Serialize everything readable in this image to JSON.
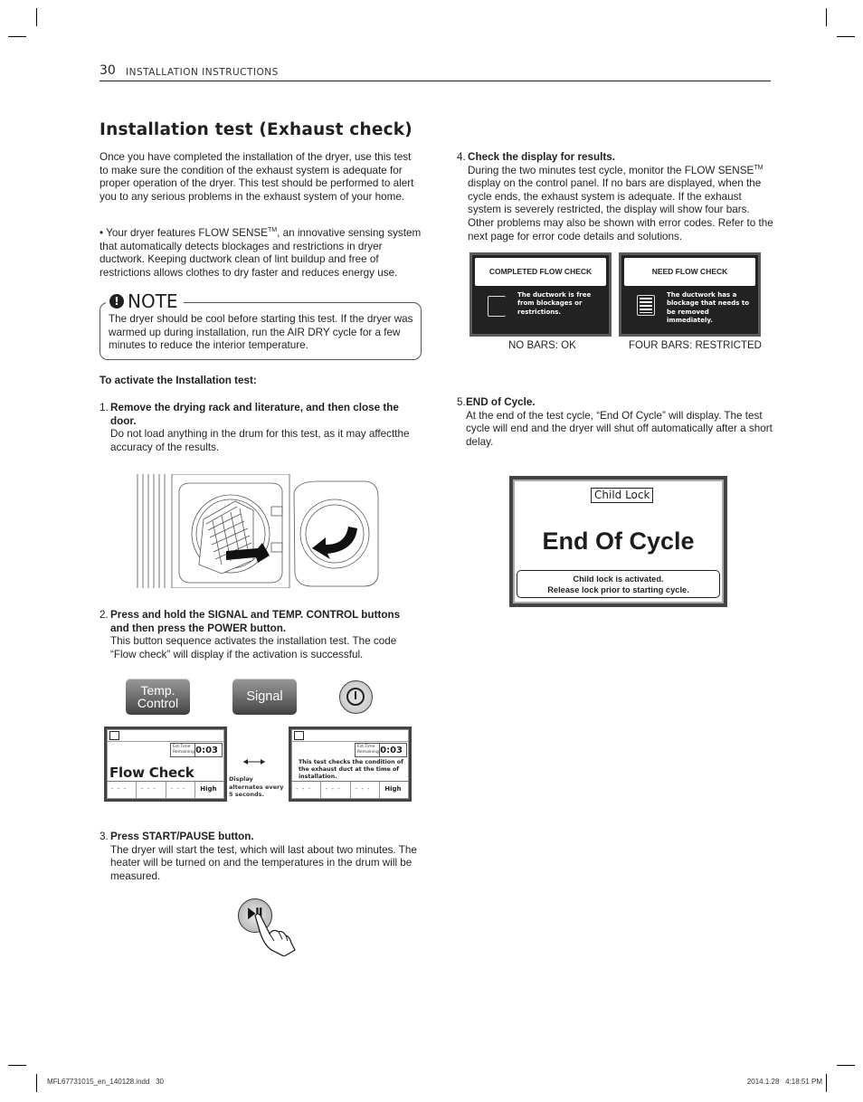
{
  "header": {
    "page_number": "30",
    "section": "INSTALLATION INSTRUCTIONS"
  },
  "title": "Installation test (Exhaust check)",
  "intro": {
    "paragraph": "Once you have completed the installation of the dryer, use this test to make sure the condition of the exhaust system is adequate for proper operation of the dryer. This test should be performed to alert you to any serious problems in the exhaust system of your home.",
    "bullet_pre": "• Your dryer features FLOW SENSE",
    "bullet_tm": "TM",
    "bullet_post": ", an innovative sensing system that automatically detects blockages and restrictions in dryer ductwork. Keeping ductwork clean of lint buildup and free of restrictions allows clothes to dry faster and reduces energy use."
  },
  "note": {
    "title": "NOTE",
    "icon": "exclamation-circle-icon",
    "text": "The dryer should be cool before starting this test. If the dryer was warmed up during installation, run the AIR DRY cycle for a few minutes to reduce the interior temperature."
  },
  "activate_heading": "To activate the Installation test:",
  "steps": [
    {
      "num": "1.",
      "heading": "Remove the drying rack and literature, and then close the door.",
      "text": "Do not load anything in the drum for this test, as it may affectthe accuracy of the results."
    },
    {
      "num": "2.",
      "heading": "Press and hold the SIGNAL and TEMP. CONTROL buttons and then press the POWER button.",
      "text": "This button sequence activates the installation test. The code “Flow check” will display if the activation is successful."
    },
    {
      "num": "3.",
      "heading": "Press START/PAUSE button.",
      "text": "The dryer will start the test, which will last about two minutes. The heater  will be turned on and the temperatures in the drum will be measured."
    },
    {
      "num": "4.",
      "heading": "Check the display for results.",
      "text_pre": "During the two minutes test cycle, monitor the FLOW SENSE",
      "text_tm": "TM",
      "text_post": " display on the control panel. If no bars are displayed, when the cycle ends, the exhaust system is adequate. If the exhaust system is severely restricted, the display will show four bars. Other problems may also be shown with error codes. Refer to the next page for error code details and solutions."
    },
    {
      "num": "5.",
      "heading": "END of Cycle.",
      "text": "At the end of the test cycle, “End Of Cycle” will display.  The test cycle will end and the dryer will shut off automatically after a short delay."
    }
  ],
  "control_buttons": {
    "temp_line1": "Temp.",
    "temp_line2": "Control",
    "signal": "Signal",
    "power_icon": "power-icon"
  },
  "lcd_displays": [
    {
      "time_label": "Est.Time Remaining",
      "time": "0:03",
      "main_text": "Flow Check",
      "cells": [
        "- - -",
        "- - -",
        "- - -",
        "High"
      ]
    },
    {
      "time_label": "Est.Time Remaining",
      "time": "0:03",
      "main_text": "This test checks the condition of the exhaust duct at the time of installation.",
      "cells": [
        "- - -",
        "- - -",
        "- - -",
        "High"
      ]
    }
  ],
  "alternate_note": "Display alternates every 5 seconds.",
  "flow_results": [
    {
      "header": "COMPLETED FLOW CHECK",
      "message": "The ductwork is free from blockages or restrictions.",
      "bars": 0,
      "caption": "NO BARS: OK"
    },
    {
      "header": "NEED FLOW CHECK",
      "message": "The ductwork has a blockage that needs to be removed immediately.",
      "bars": 4,
      "caption": "FOUR BARS: RESTRICTED"
    }
  ],
  "end_of_cycle_display": {
    "badge": "Child Lock",
    "main": "End Of Cycle",
    "message_line1": "Child lock is activated.",
    "message_line2": "Release lock prior to starting cycle."
  },
  "footer": {
    "left": "MFL67731015_en_140128.indd   30",
    "right": "2014.1.28   4:18:51 PM"
  }
}
